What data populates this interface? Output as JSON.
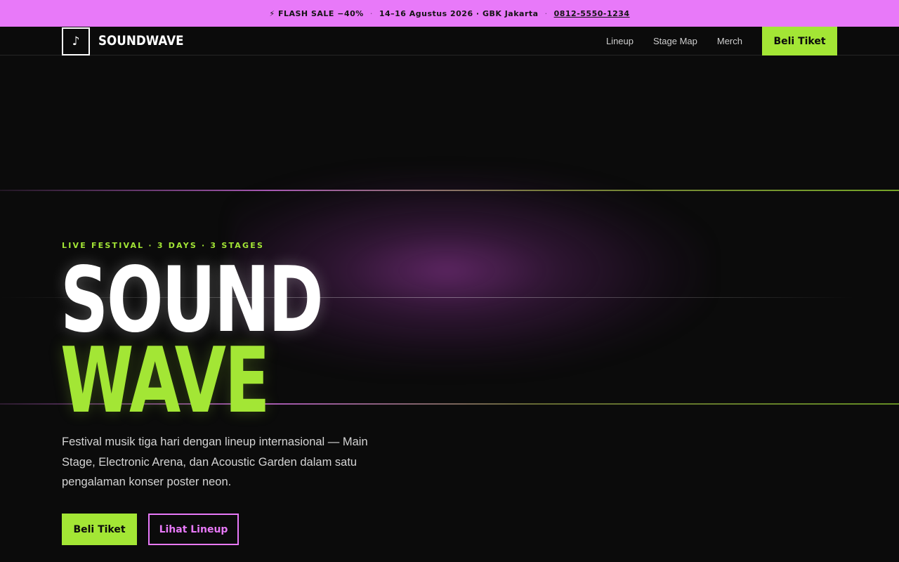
{
  "announcement": {
    "sale": "⚡ FLASH SALE −40%",
    "separator": "·",
    "event_info": "14–16 Agustus 2026 · GBK Jakarta",
    "phone": "0812-5550-1234"
  },
  "nav": {
    "logo_icon": "♪",
    "logo_text": "SOUNDWAVE",
    "links": [
      "Lineup",
      "Stage Map",
      "Merch"
    ],
    "cta": "Beli Tiket"
  },
  "hero": {
    "eyebrow": "LIVE FESTIVAL · 3 DAYS · 3 STAGES",
    "title_line1": "SOUND",
    "title_line2": "WAVE",
    "description": "Festival musik tiga hari dengan lineup internasional — Main Stage, Electronic Arena, dan Acoustic Garden dalam satu pengalaman konser poster neon.",
    "primary_button": "Beli Tiket",
    "secondary_button": "Lihat Lineup"
  },
  "colors": {
    "accent_green": "#a3e635",
    "accent_pink": "#e879f9",
    "background": "#0b0b0b"
  }
}
